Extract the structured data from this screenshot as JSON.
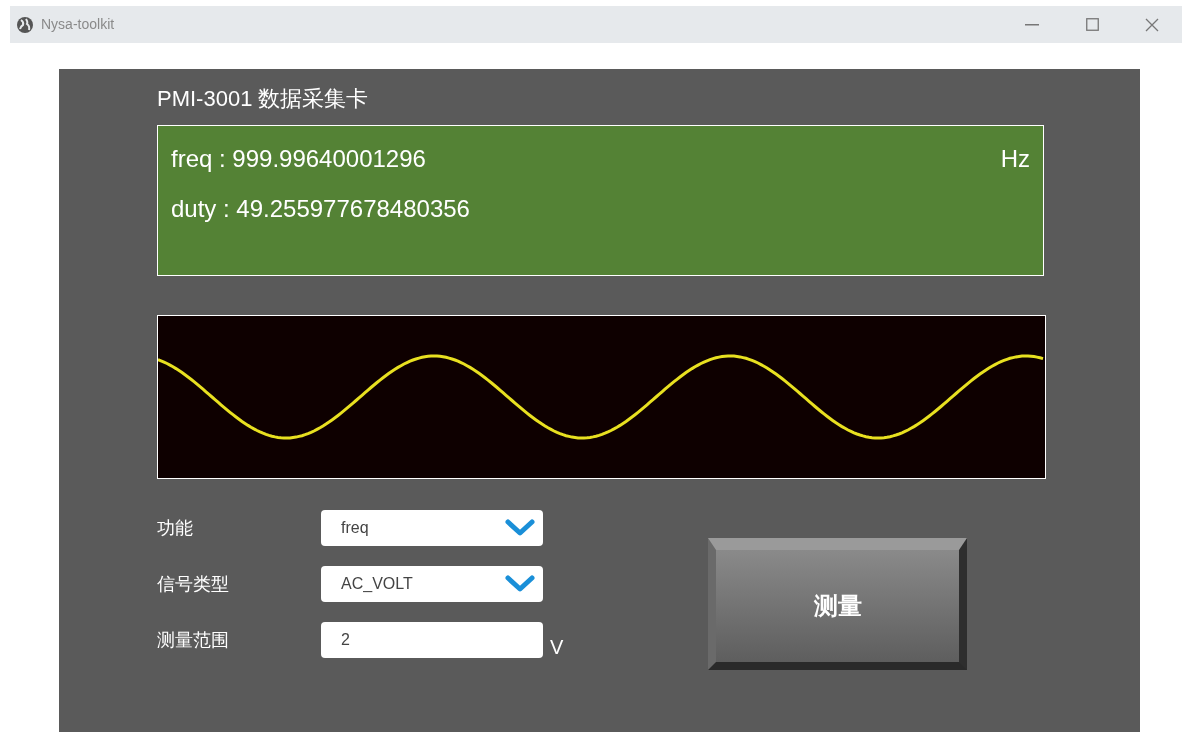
{
  "window": {
    "title": "Nysa-toolkit"
  },
  "panel": {
    "title": "PMI-3001 数据采集卡"
  },
  "readout": {
    "lines": [
      {
        "text": "freq : 999.99640001296",
        "unit": "Hz"
      },
      {
        "text": "duty : 49.255977678480356"
      }
    ]
  },
  "form": [
    {
      "kind": "select",
      "label": "功能",
      "value": "freq"
    },
    {
      "kind": "select",
      "label": "信号类型",
      "value": "AC_VOLT"
    },
    {
      "kind": "input",
      "label": "测量范围",
      "value": "2",
      "unit": "V"
    }
  ],
  "measure_button": {
    "label": "测量"
  }
}
